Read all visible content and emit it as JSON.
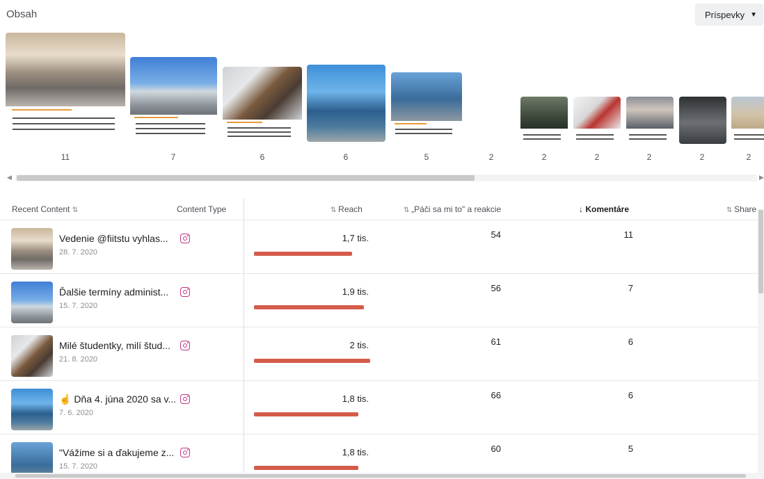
{
  "header": {
    "title": "Obsah",
    "dropdown_label": "Príspevky"
  },
  "posts_strip": {
    "counts": [
      "11",
      "7",
      "6",
      "6",
      "5",
      "2",
      "2",
      "2",
      "2",
      "2",
      "2"
    ]
  },
  "table": {
    "columns": {
      "recent_content": "Recent Content",
      "content_type": "Content Type",
      "reach": "Reach",
      "likes": "„Páči sa mi to\" a reakcie",
      "comments": "Komentáre",
      "shares": "Share"
    },
    "rows": [
      {
        "title": "Vedenie @fiitstu vyhlas...",
        "date": "28. 7. 2020",
        "type": "instagram-icon",
        "reach": "1,7 tis.",
        "reach_fraction": 0.82,
        "likes": "54",
        "comments": "11"
      },
      {
        "title": "Ďalšie termíny administ...",
        "date": "15. 7. 2020",
        "type": "instagram-icon",
        "reach": "1,9 tis.",
        "reach_fraction": 0.92,
        "likes": "56",
        "comments": "7"
      },
      {
        "title": "Milé študentky, milí štud...",
        "date": "21. 8. 2020",
        "type": "instagram-icon",
        "reach": "2 tis.",
        "reach_fraction": 0.97,
        "likes": "61",
        "comments": "6"
      },
      {
        "title": "☝ Dňa 4. júna 2020 sa v...",
        "date": "7. 6. 2020",
        "type": "instagram-icon",
        "reach": "1,8 tis.",
        "reach_fraction": 0.87,
        "likes": "66",
        "comments": "6"
      },
      {
        "title": "\"Vážime si a ďakujeme z...",
        "date": "15. 7. 2020",
        "type": "instagram-icon",
        "reach": "1,8 tis.",
        "reach_fraction": 0.87,
        "likes": "60",
        "comments": "5"
      }
    ]
  },
  "colors": {
    "accent_bar": "#d35c49",
    "instagram": "#c13584"
  }
}
